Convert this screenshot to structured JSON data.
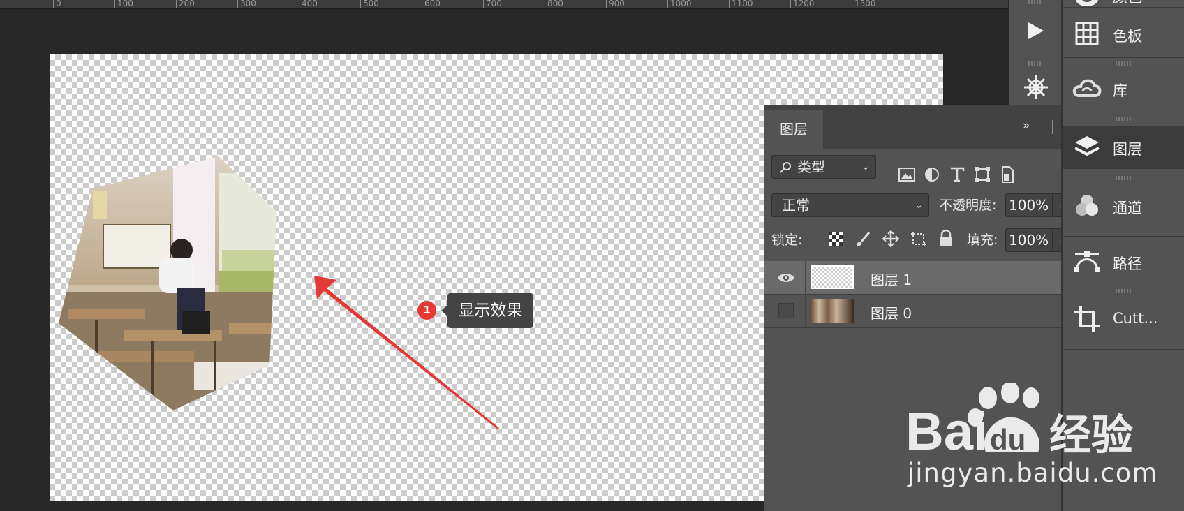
{
  "ruler": {
    "ticks": [
      "0",
      "100",
      "200",
      "300",
      "400",
      "500",
      "600",
      "700",
      "800",
      "900",
      "1000",
      "1100",
      "1200",
      "1300"
    ]
  },
  "annotation": {
    "number": "1",
    "label": "显示效果"
  },
  "layers_panel": {
    "tab_label": "图层",
    "collapse_icon": "»",
    "filter": {
      "value": "类型",
      "options": [
        "image-filter-icon",
        "adjustment-filter-icon",
        "type-filter-icon",
        "shape-filter-icon",
        "smart-object-filter-icon"
      ]
    },
    "blend_mode": "正常",
    "opacity_label": "不透明度:",
    "opacity_value": "100%",
    "lock_label": "锁定:",
    "fill_label": "填充:",
    "fill_value": "100%",
    "layers": [
      {
        "name": "图层 1",
        "visible": true,
        "selected": true
      },
      {
        "name": "图层 0",
        "visible": false,
        "selected": false
      }
    ]
  },
  "dock": {
    "items": [
      {
        "label": "颜色",
        "icon": "color-wheel-icon"
      },
      {
        "label": "色板",
        "icon": "swatches-icon"
      },
      {
        "label": "库",
        "icon": "creative-cloud-libraries-icon"
      },
      {
        "label": "图层",
        "icon": "layers-icon",
        "selected": true
      },
      {
        "label": "通道",
        "icon": "channels-icon"
      },
      {
        "label": "路径",
        "icon": "paths-icon"
      },
      {
        "label": "Cutt...",
        "icon": "crop-icon"
      }
    ]
  },
  "watermark": {
    "brand": "Bai",
    "mid": "du",
    "suffix": "经验",
    "domain": "jingyan.baidu.com"
  },
  "colors": {
    "accent_red": "#e53935",
    "panel": "#535353",
    "background": "#282828"
  }
}
